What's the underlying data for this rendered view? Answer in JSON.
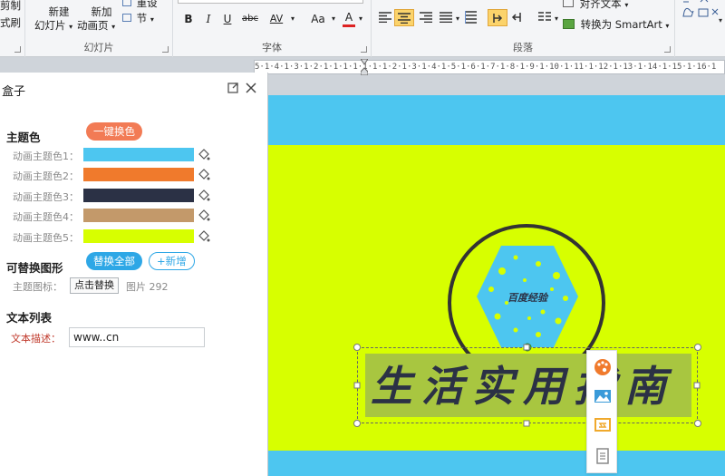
{
  "ribbon": {
    "clipboard": {
      "partial_top": "剪制",
      "partial_bottom": "式刷"
    },
    "slides": {
      "new_slide_line1": "新建",
      "new_slide_line2": "幻灯片",
      "new_anim_line1": "新加",
      "new_anim_line2": "动画页",
      "reset": "重设",
      "section": "节",
      "group_label": "幻灯片"
    },
    "font": {
      "bold": "B",
      "italic": "I",
      "underline": "U",
      "strike": "abc",
      "spacing": "AV",
      "case": "Aa",
      "color": "A",
      "group_label": "字体"
    },
    "paragraph": {
      "align_text": "对齐文本",
      "smartart": "转换为 SmartArt",
      "group_label": "段落"
    }
  },
  "ruler": {
    "text": "5·1·4·1·3·1·2·1·1·1·1·1·1·1·2·1·3·1·4·1·5·1·6·1·7·1·8·1·9·1·10·1·11·1·12·1·13·1·14·1·15·1·16·1"
  },
  "panel": {
    "title": "盒子",
    "theme": {
      "title": "主题色",
      "one_click_label": "一键换色",
      "colors": [
        {
          "label": "动画主题色1：",
          "color": "#4dc6f0"
        },
        {
          "label": "动画主题色2：",
          "color": "#f07a2c"
        },
        {
          "label": "动画主题色3：",
          "color": "#2b3145"
        },
        {
          "label": "动画主题色4：",
          "color": "#c3996a"
        },
        {
          "label": "动画主题色5：",
          "color": "#d7ff00"
        }
      ]
    },
    "shapes": {
      "title": "可替换图形",
      "replace_all_label": "替换全部",
      "add_label": "+新增",
      "icon_label": "主题图标：",
      "replace_button": "点击替换",
      "image_name": "图片 292"
    },
    "textlist": {
      "title": "文本列表",
      "desc_label": "文本描述：",
      "desc_value": "www..cn"
    }
  },
  "slide": {
    "badge_text": "百度经验",
    "calligraphy": "生活实用指南",
    "colors": {
      "background": "#d7ff00",
      "band": "#4dc6f0",
      "ring": "#333333",
      "hexagon": "#4dc6f0"
    }
  },
  "float_toolbar": {
    "icons": [
      "palette-icon",
      "picture-icon",
      "replace-icon",
      "document-icon"
    ]
  }
}
